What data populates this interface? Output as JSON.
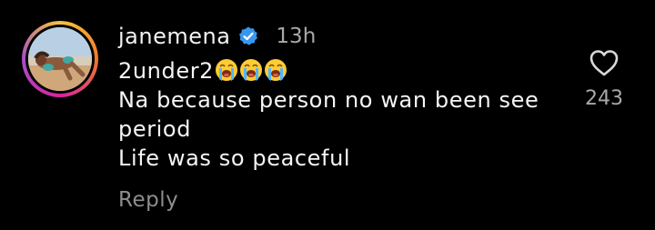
{
  "comment": {
    "username": "janemena",
    "time": "13h",
    "lines": [
      "2under2",
      "Na because person no wan been see",
      "period",
      "Life was so peaceful"
    ],
    "emojis": [
      "loudly-crying-face",
      "loudly-crying-face",
      "loudly-crying-face"
    ],
    "reply_label": "Reply",
    "like_count": "243"
  },
  "colors": {
    "background": "#000000",
    "text": "#f5f5f5",
    "muted": "#a8a8a8",
    "verified": "#3797f0"
  },
  "icons": {
    "verified": "verified-badge-icon",
    "like": "heart-outline-icon"
  }
}
